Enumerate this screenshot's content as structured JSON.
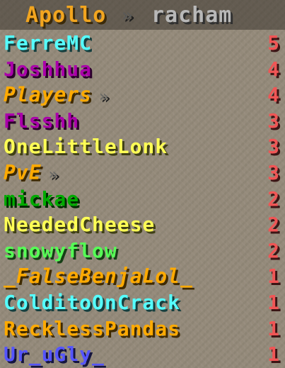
{
  "scoreboard": {
    "title": "Apollo",
    "separator": "»",
    "subtitle": "racham",
    "score_color": "#F05555",
    "rows": [
      {
        "name": "FerreMC",
        "score": "5",
        "color": "#55FFFF",
        "shadow": "#153F3F",
        "italic": false,
        "group": false
      },
      {
        "name": "Joshhua",
        "score": "4",
        "color": "#AA00AA",
        "shadow": "#2A002A",
        "italic": false,
        "group": false
      },
      {
        "name": "Players",
        "score": "4",
        "color": "#FFAA00",
        "shadow": "#3F2A00",
        "italic": true,
        "group": true
      },
      {
        "name": "Flsshh",
        "score": "3",
        "color": "#AA00AA",
        "shadow": "#2A002A",
        "italic": false,
        "group": false
      },
      {
        "name": "OneLittleLonk",
        "score": "3",
        "color": "#FFFF55",
        "shadow": "#3F3F15",
        "italic": false,
        "group": false
      },
      {
        "name": "PvE",
        "score": "3",
        "color": "#FFAA00",
        "shadow": "#3F2A00",
        "italic": true,
        "group": true
      },
      {
        "name": "mickae",
        "score": "2",
        "color": "#00AA00",
        "shadow": "#002A00",
        "italic": false,
        "group": false
      },
      {
        "name": "NeededCheese",
        "score": "2",
        "color": "#FFFF55",
        "shadow": "#3F3F15",
        "italic": false,
        "group": false
      },
      {
        "name": "snowyflow",
        "score": "2",
        "color": "#55FF55",
        "shadow": "#153F15",
        "italic": false,
        "group": false
      },
      {
        "name": "_FalseBenjaLol_",
        "score": "1",
        "color": "#FFAA00",
        "shadow": "#3F2A00",
        "italic": true,
        "group": false
      },
      {
        "name": "ColditoOnCrack",
        "score": "1",
        "color": "#55FFFF",
        "shadow": "#153F3F",
        "italic": false,
        "group": false
      },
      {
        "name": "RecklessPandas",
        "score": "1",
        "color": "#FFAA00",
        "shadow": "#3F2A00",
        "italic": false,
        "group": false
      },
      {
        "name": "Ur_uGly_",
        "score": "1",
        "color": "#5555FF",
        "shadow": "#15153F",
        "italic": false,
        "group": false
      }
    ]
  }
}
